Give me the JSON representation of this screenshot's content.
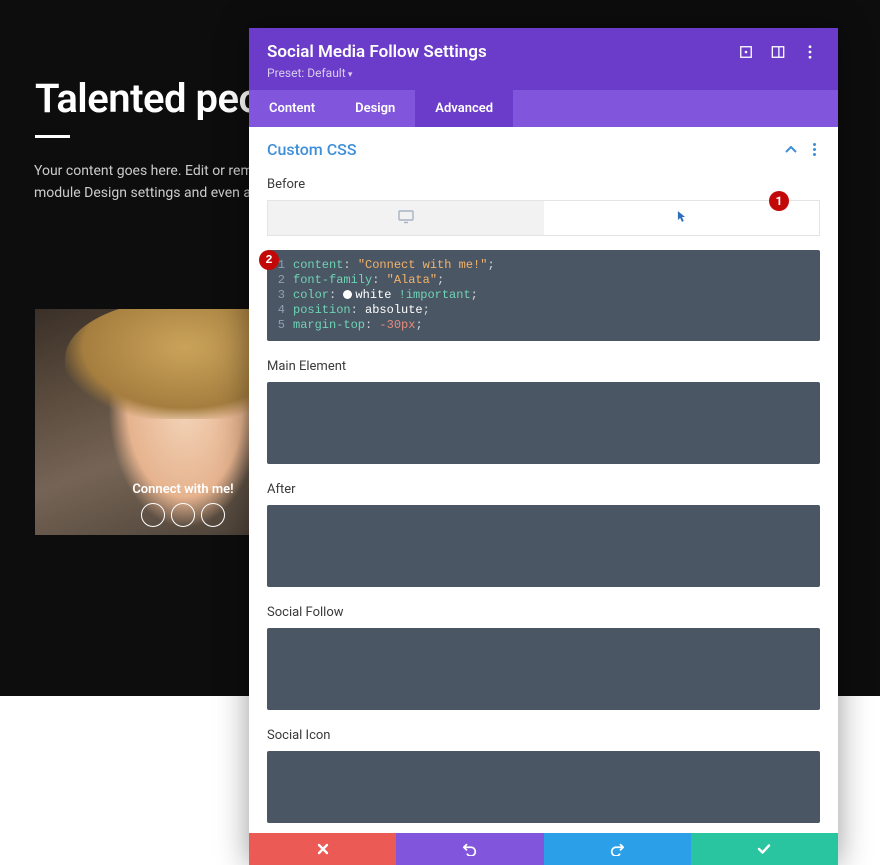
{
  "background": {
    "heading": "Talented peo",
    "paragraph_line1": "Your content goes here. Edit or remove",
    "paragraph_line2": "module Design settings and even appl",
    "card_label": "Connect with me!"
  },
  "modal": {
    "title": "Social Media Follow Settings",
    "preset": "Preset: Default",
    "tabs": {
      "content": "Content",
      "design": "Design",
      "advanced": "Advanced"
    },
    "section_title": "Custom CSS",
    "fields": {
      "before": "Before",
      "main_element": "Main Element",
      "after": "After",
      "social_follow": "Social Follow",
      "social_icon": "Social Icon"
    },
    "css_lines": [
      {
        "n": "1",
        "prop": "content",
        "sep": ": ",
        "val": "\"Connect with me!\"",
        "type": "str",
        "end": ";"
      },
      {
        "n": "2",
        "prop": "font-family",
        "sep": ": ",
        "val": "\"Alata\"",
        "type": "str",
        "end": ";"
      },
      {
        "n": "3",
        "prop": "color",
        "sep": ": ",
        "val": "white",
        "type": "color",
        "imp": " !important",
        "end": ";"
      },
      {
        "n": "4",
        "prop": "position",
        "sep": ": ",
        "val": "absolute",
        "type": "ident",
        "end": ";"
      },
      {
        "n": "5",
        "prop": "margin-top",
        "sep": ": ",
        "val": "-30px",
        "type": "num",
        "end": ";"
      }
    ]
  },
  "badges": {
    "one": "1",
    "two": "2"
  }
}
